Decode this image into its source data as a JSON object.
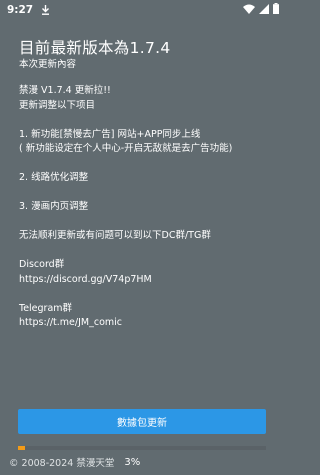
{
  "status_bar": {
    "time": "9:27"
  },
  "dialog": {
    "title": "目前最新版本為1.7.4",
    "subtitle": "本次更新內容",
    "notes": [
      "禁漫 V1.7.4 更新拉!!",
      "更新调整以下项目",
      "",
      "1. 新功能[禁慢去广告] 网站+APP同步上线",
      "( 新功能设定在个人中心-开启无敌就是去广告功能)",
      "",
      "2. 线路优化调整",
      "",
      "3. 漫画内页调整",
      "",
      "无法顺利更新或有问题可以到以下DC群/TG群",
      "",
      "Discord群",
      "https://discord.gg/V74p7HM",
      "",
      "Telegram群",
      "https://t.me/JM_comic"
    ],
    "update_button": "數據包更新",
    "progress_percent": 3,
    "progress_label": "3%",
    "copyright": "© 2008-2024 禁漫天堂"
  },
  "colors": {
    "background": "#616b70",
    "button": "#2c97e6",
    "progress": "#f39b18"
  }
}
